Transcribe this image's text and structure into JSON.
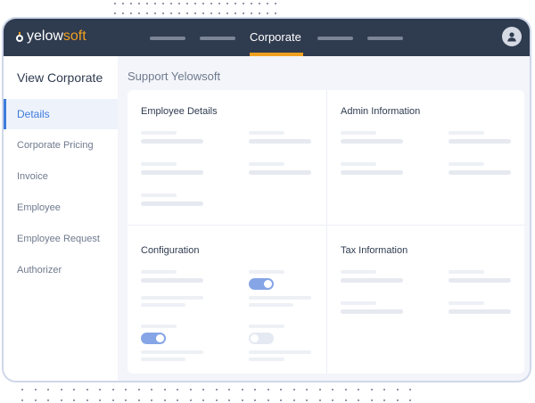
{
  "brand": {
    "name_part1": "yelow",
    "name_part2": "soft",
    "accent": "#f0a020",
    "topbar_color": "#2f3b4f"
  },
  "topnav": {
    "active_tab": "Corporate"
  },
  "sidebar": {
    "title": "View Corporate",
    "items": [
      {
        "label": "Details",
        "active": true
      },
      {
        "label": "Corporate Pricing",
        "active": false
      },
      {
        "label": "Invoice",
        "active": false
      },
      {
        "label": "Employee",
        "active": false
      },
      {
        "label": "Employee Request",
        "active": false
      },
      {
        "label": "Authorizer",
        "active": false
      }
    ]
  },
  "main": {
    "page_title": "Support Yelowsoft",
    "sections": [
      {
        "title": "Employee Details"
      },
      {
        "title": "Admin Information"
      },
      {
        "title": "Configuration"
      },
      {
        "title": "Tax Information"
      }
    ],
    "toggles": [
      {
        "state": "on"
      },
      {
        "state": "on"
      },
      {
        "state": "off"
      }
    ]
  }
}
